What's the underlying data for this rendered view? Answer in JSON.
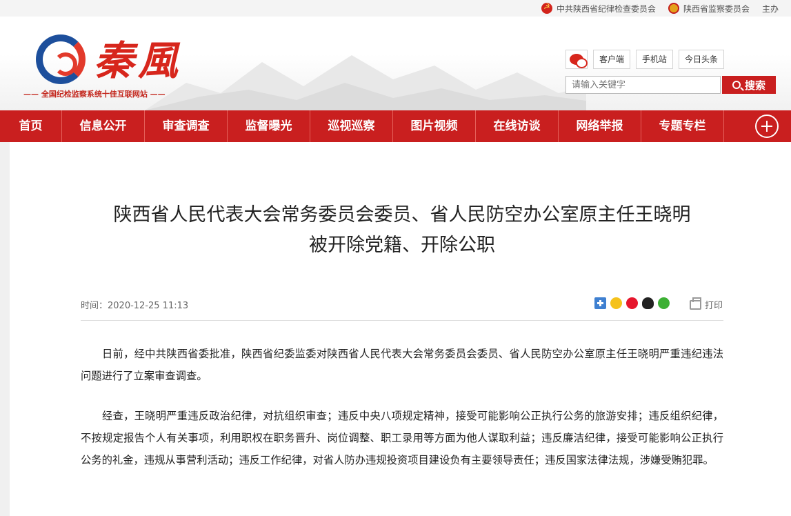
{
  "topbar": {
    "links": [
      {
        "label": "中共陕西省纪律检查委员会",
        "icon": "party-emblem-icon"
      },
      {
        "label": "陕西省监察委员会",
        "icon": "national-emblem-icon"
      },
      {
        "label": "主办"
      }
    ]
  },
  "header": {
    "logo_text": "秦風",
    "slogan": "—— 全国纪检监察系统十佳互联网站 ——",
    "client_buttons": [
      "客户端",
      "手机站",
      "今日头条"
    ],
    "search": {
      "placeholder": "请输入关键字",
      "button_label": "搜索"
    }
  },
  "nav": {
    "items": [
      "首页",
      "信息公开",
      "审查调查",
      "监督曝光",
      "巡视巡察",
      "图片视频",
      "在线访谈",
      "网络举报",
      "专题专栏"
    ]
  },
  "article": {
    "title_line1": "陕西省人民代表大会常务委员会委员、省人民防空办公室原主任王晓明",
    "title_line2": "被开除党籍、开除公职",
    "time_label": "时间：",
    "time_value": "2020-12-25 11:13",
    "share_icons": [
      "share-more-icon",
      "qzone-icon",
      "weibo-icon",
      "qq-icon",
      "wechat-icon"
    ],
    "print_label": "打印",
    "paragraphs": [
      "日前，经中共陕西省委批准，陕西省纪委监委对陕西省人民代表大会常务委员会委员、省人民防空办公室原主任王晓明严重违纪违法问题进行了立案审查调查。",
      "经查，王晓明严重违反政治纪律，对抗组织审查；违反中央八项规定精神，接受可能影响公正执行公务的旅游安排；违反组织纪律，不按规定报告个人有关事项，利用职权在职务晋升、岗位调整、职工录用等方面为他人谋取利益；违反廉洁纪律，接受可能影响公正执行公务的礼金，违规从事营利活动；违反工作纪律，对省人防办违规投资项目建设负有主要领导责任；违反国家法律法规，涉嫌受贿犯罪。"
    ]
  },
  "colors": {
    "brand_red": "#c91f1f",
    "logo_blue": "#1d4f9c"
  }
}
